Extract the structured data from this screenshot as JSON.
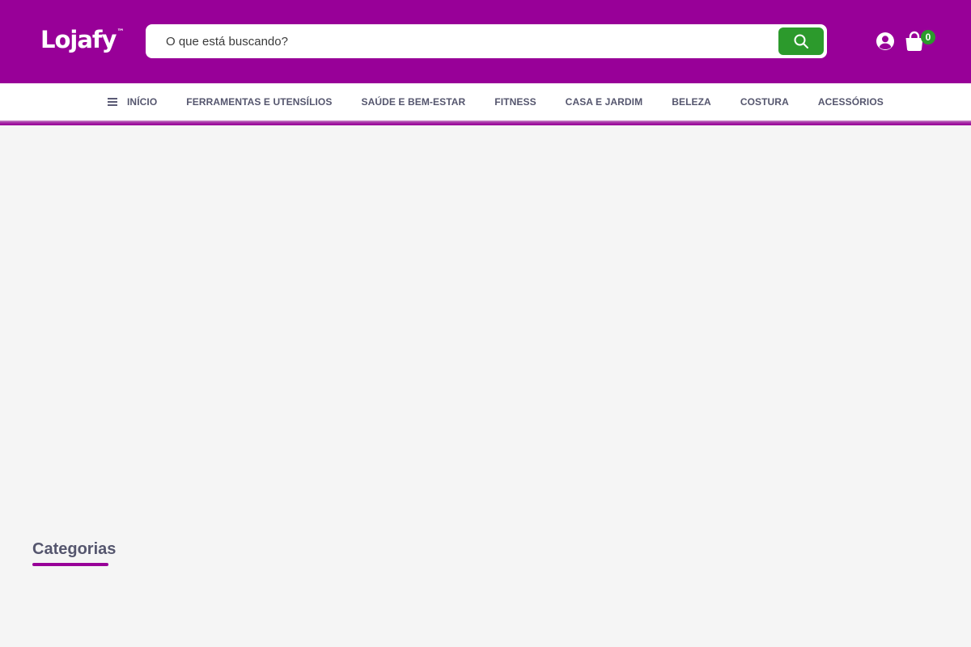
{
  "header": {
    "logo_text": "Lojafy",
    "logo_mark": "™",
    "search": {
      "placeholder": "O que está buscando?"
    },
    "cart_count": "0",
    "icons": {
      "search": "search-icon",
      "user": "user-icon",
      "cart": "shopping-bag-icon",
      "menu": "hamburger-menu-icon"
    }
  },
  "nav": {
    "items": [
      {
        "label": "INÍCIO"
      },
      {
        "label": "FERRAMENTAS E UTENSÍLIOS"
      },
      {
        "label": "SAÚDE E BEM-ESTAR"
      },
      {
        "label": "FITNESS"
      },
      {
        "label": "CASA E JARDIM"
      },
      {
        "label": "BELEZA"
      },
      {
        "label": "COSTURA"
      },
      {
        "label": "ACESSÓRIOS"
      }
    ]
  },
  "main": {
    "categories_title": "Categorias"
  },
  "colors": {
    "brand": "#980098",
    "accent_green": "#2c9a2c",
    "nav_text": "#55566e",
    "background": "#f5f5f5"
  }
}
